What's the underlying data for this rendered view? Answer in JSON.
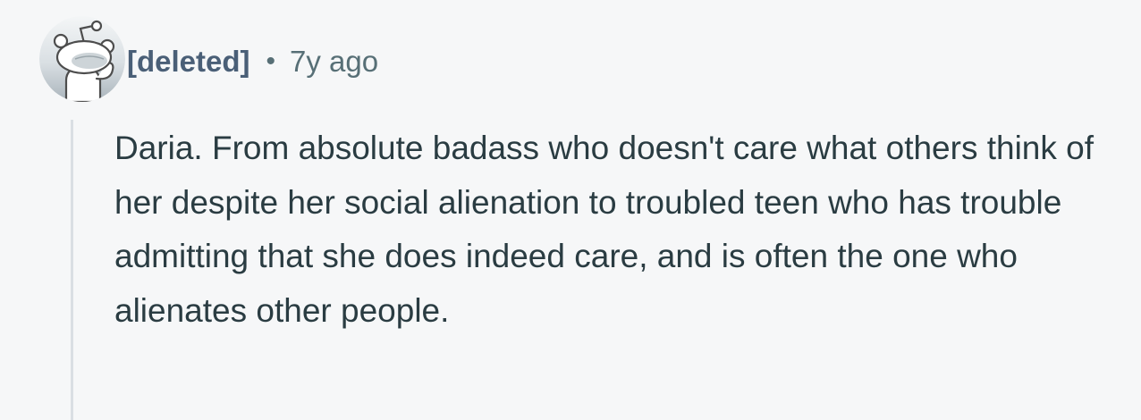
{
  "comment": {
    "author": "[deleted]",
    "separator": "•",
    "timestamp": "7y ago",
    "body": "Daria. From absolute badass who doesn't care what others think of her despite her social alienation to troubled teen who has trouble admitting that she does indeed care, and is often the one who alienates other people.",
    "avatar_icon": "snoo-avatar-icon"
  },
  "colors": {
    "background": "#f6f7f8",
    "author": "#4a5f77",
    "meta": "#576f76",
    "body_text": "#2a3c42",
    "thread_line": "#dadfe3"
  }
}
